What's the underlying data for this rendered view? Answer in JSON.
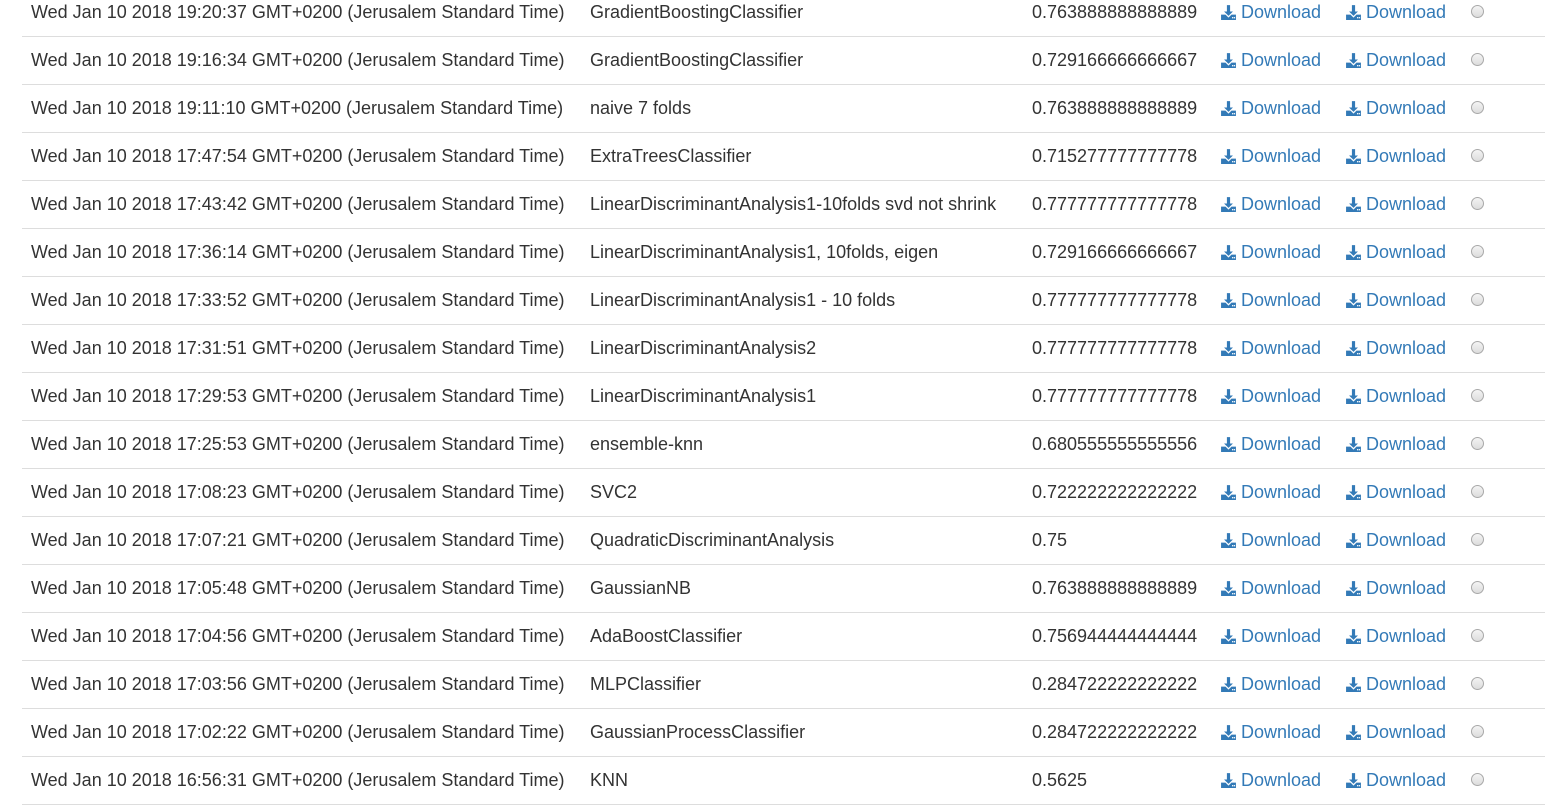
{
  "rows": [
    {
      "date": "Wed Jan 10 2018 19:20:37 GMT+0200 (Jerusalem Standard Time)",
      "name": "GradientBoostingClassifier",
      "score": "0.763888888888889",
      "download1": "Download",
      "download2": "Download"
    },
    {
      "date": "Wed Jan 10 2018 19:16:34 GMT+0200 (Jerusalem Standard Time)",
      "name": "GradientBoostingClassifier",
      "score": "0.729166666666667",
      "download1": "Download",
      "download2": "Download"
    },
    {
      "date": "Wed Jan 10 2018 19:11:10 GMT+0200 (Jerusalem Standard Time)",
      "name": "naive 7 folds",
      "score": "0.763888888888889",
      "download1": "Download",
      "download2": "Download"
    },
    {
      "date": "Wed Jan 10 2018 17:47:54 GMT+0200 (Jerusalem Standard Time)",
      "name": "ExtraTreesClassifier",
      "score": "0.715277777777778",
      "download1": "Download",
      "download2": "Download"
    },
    {
      "date": "Wed Jan 10 2018 17:43:42 GMT+0200 (Jerusalem Standard Time)",
      "name": "LinearDiscriminantAnalysis1-10folds svd not shrink",
      "score": "0.777777777777778",
      "download1": "Download",
      "download2": "Download"
    },
    {
      "date": "Wed Jan 10 2018 17:36:14 GMT+0200 (Jerusalem Standard Time)",
      "name": "LinearDiscriminantAnalysis1, 10folds, eigen",
      "score": "0.729166666666667",
      "download1": "Download",
      "download2": "Download"
    },
    {
      "date": "Wed Jan 10 2018 17:33:52 GMT+0200 (Jerusalem Standard Time)",
      "name": "LinearDiscriminantAnalysis1 - 10 folds",
      "score": "0.777777777777778",
      "download1": "Download",
      "download2": "Download"
    },
    {
      "date": "Wed Jan 10 2018 17:31:51 GMT+0200 (Jerusalem Standard Time)",
      "name": "LinearDiscriminantAnalysis2",
      "score": "0.777777777777778",
      "download1": "Download",
      "download2": "Download"
    },
    {
      "date": "Wed Jan 10 2018 17:29:53 GMT+0200 (Jerusalem Standard Time)",
      "name": "LinearDiscriminantAnalysis1",
      "score": "0.777777777777778",
      "download1": "Download",
      "download2": "Download"
    },
    {
      "date": "Wed Jan 10 2018 17:25:53 GMT+0200 (Jerusalem Standard Time)",
      "name": "ensemble-knn",
      "score": "0.680555555555556",
      "download1": "Download",
      "download2": "Download"
    },
    {
      "date": "Wed Jan 10 2018 17:08:23 GMT+0200 (Jerusalem Standard Time)",
      "name": "SVC2",
      "score": "0.722222222222222",
      "download1": "Download",
      "download2": "Download"
    },
    {
      "date": "Wed Jan 10 2018 17:07:21 GMT+0200 (Jerusalem Standard Time)",
      "name": "QuadraticDiscriminantAnalysis",
      "score": "0.75",
      "download1": "Download",
      "download2": "Download"
    },
    {
      "date": "Wed Jan 10 2018 17:05:48 GMT+0200 (Jerusalem Standard Time)",
      "name": "GaussianNB",
      "score": "0.763888888888889",
      "download1": "Download",
      "download2": "Download"
    },
    {
      "date": "Wed Jan 10 2018 17:04:56 GMT+0200 (Jerusalem Standard Time)",
      "name": "AdaBoostClassifier",
      "score": "0.756944444444444",
      "download1": "Download",
      "download2": "Download"
    },
    {
      "date": "Wed Jan 10 2018 17:03:56 GMT+0200 (Jerusalem Standard Time)",
      "name": "MLPClassifier",
      "score": "0.284722222222222",
      "download1": "Download",
      "download2": "Download"
    },
    {
      "date": "Wed Jan 10 2018 17:02:22 GMT+0200 (Jerusalem Standard Time)",
      "name": "GaussianProcessClassifier",
      "score": "0.284722222222222",
      "download1": "Download",
      "download2": "Download"
    },
    {
      "date": "Wed Jan 10 2018 16:56:31 GMT+0200 (Jerusalem Standard Time)",
      "name": "KNN",
      "score": "0.5625",
      "download1": "Download",
      "download2": "Download"
    }
  ],
  "icons": {
    "download": "download-icon",
    "select": "radio-button"
  },
  "colors": {
    "link": "#337ab7",
    "text": "#333333",
    "border": "#dddddd"
  }
}
